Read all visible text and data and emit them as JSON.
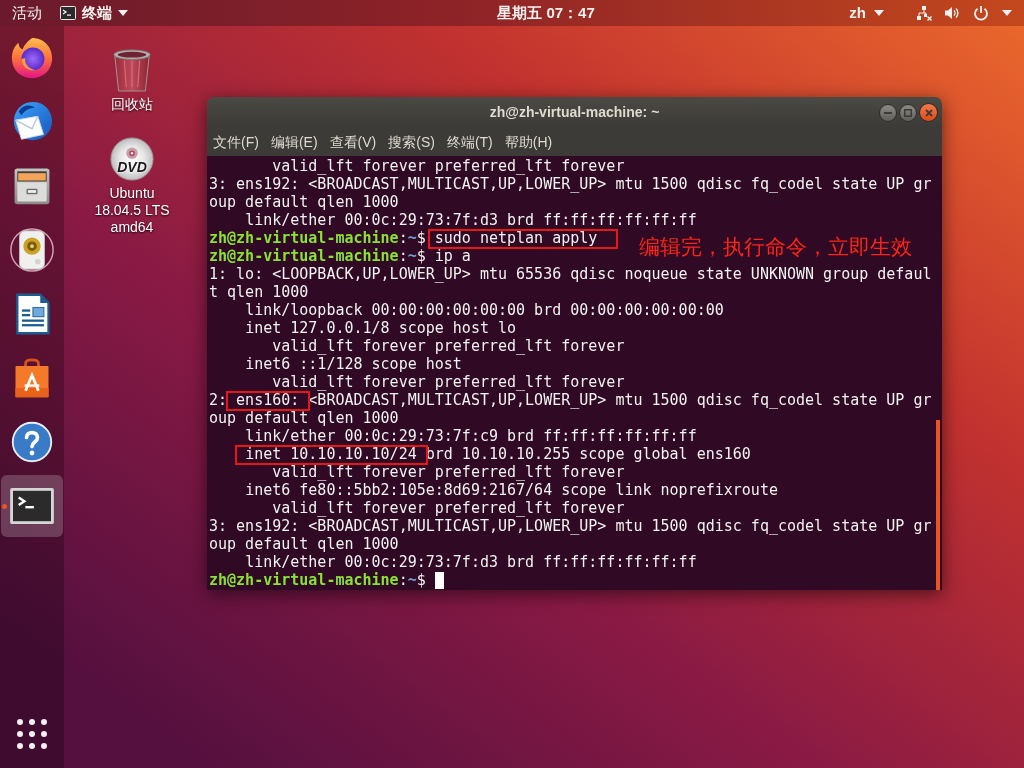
{
  "top_bar": {
    "activities": "活动",
    "app_menu": "终端",
    "clock": "星期五 07：47",
    "input_method": "zh"
  },
  "dock": {
    "items": [
      {
        "active": false
      },
      {
        "active": false
      },
      {
        "active": false
      },
      {
        "active": false
      },
      {
        "active": false
      },
      {
        "active": false
      },
      {
        "active": false
      },
      {
        "active": true
      }
    ]
  },
  "desktop_icons": [
    {
      "label": "回收站"
    },
    {
      "label": "Ubuntu 18.04.5 LTS amd64",
      "logo_text": "DVD"
    }
  ],
  "window": {
    "title": "zh@zh-virtual-machine: ~",
    "menu": [
      "文件(F)",
      "编辑(E)",
      "查看(V)",
      "搜索(S)",
      "终端(T)",
      "帮助(H)"
    ],
    "terminal": {
      "lines": [
        {
          "kind": "output",
          "text": "       valid_lft forever preferred_lft forever"
        },
        {
          "kind": "output",
          "text": "3: ens192: <BROADCAST,MULTICAST,UP,LOWER_UP> mtu 1500 qdisc fq_codel state UP gr"
        },
        {
          "kind": "output",
          "text": "oup default qlen 1000"
        },
        {
          "kind": "output",
          "text": "    link/ether 00:0c:29:73:7f:d3 brd ff:ff:ff:ff:ff:ff"
        },
        {
          "kind": "prompt",
          "user": "zh@zh-virtual-machine",
          "colon": ":",
          "path": "~",
          "dollar": "$",
          "command": "sudo netplan apply",
          "command_boxed": true,
          "note": "编辑完，执行命令，立即生效",
          "cursor": false
        },
        {
          "kind": "prompt",
          "user": "zh@zh-virtual-machine",
          "colon": ":",
          "path": "~",
          "dollar": "$",
          "command": "ip a",
          "command_boxed": false,
          "cursor": false
        },
        {
          "kind": "output",
          "text": "1: lo: <LOOPBACK,UP,LOWER_UP> mtu 65536 qdisc noqueue state UNKNOWN group defaul"
        },
        {
          "kind": "output",
          "text": "t qlen 1000"
        },
        {
          "kind": "output",
          "text": "    link/loopback 00:00:00:00:00:00 brd 00:00:00:00:00:00"
        },
        {
          "kind": "output",
          "text": "    inet 127.0.0.1/8 scope host lo"
        },
        {
          "kind": "output",
          "text": "       valid_lft forever preferred_lft forever"
        },
        {
          "kind": "output",
          "text": "    inet6 ::1/128 scope host"
        },
        {
          "kind": "output",
          "text": "       valid_lft forever preferred_lft forever"
        },
        {
          "kind": "output",
          "segments": [
            {
              "text": "2: ",
              "boxed": false
            },
            {
              "text": "ens160:",
              "boxed": true
            },
            {
              "text": " <BROADCAST,MULTICAST,UP,LOWER_UP> mtu 1500 qdisc fq_codel state UP gr",
              "boxed": false
            }
          ]
        },
        {
          "kind": "output",
          "text": "oup default qlen 1000"
        },
        {
          "kind": "output",
          "text": "    link/ether 00:0c:29:73:7f:c9 brd ff:ff:ff:ff:ff:ff"
        },
        {
          "kind": "output",
          "segments": [
            {
              "text": "    inet 10.10.10.10/24",
              "boxed": true
            },
            {
              "text": " brd 10.10.10.255 scope global ens160",
              "boxed": false
            }
          ]
        },
        {
          "kind": "output",
          "text": "       valid_lft forever preferred_lft forever"
        },
        {
          "kind": "output",
          "text": "    inet6 fe80::5bb2:105e:8d69:2167/64 scope link noprefixroute"
        },
        {
          "kind": "output",
          "text": "       valid_lft forever preferred_lft forever"
        },
        {
          "kind": "output",
          "text": "3: ens192: <BROADCAST,MULTICAST,UP,LOWER_UP> mtu 1500 qdisc fq_codel state UP gr"
        },
        {
          "kind": "output",
          "text": "oup default qlen 1000"
        },
        {
          "kind": "output",
          "text": "    link/ether 00:0c:29:73:7f:d3 brd ff:ff:ff:ff:ff:ff"
        },
        {
          "kind": "prompt",
          "user": "zh@zh-virtual-machine",
          "colon": ":",
          "path": "~",
          "dollar": "$",
          "cursor": true
        }
      ]
    }
  }
}
